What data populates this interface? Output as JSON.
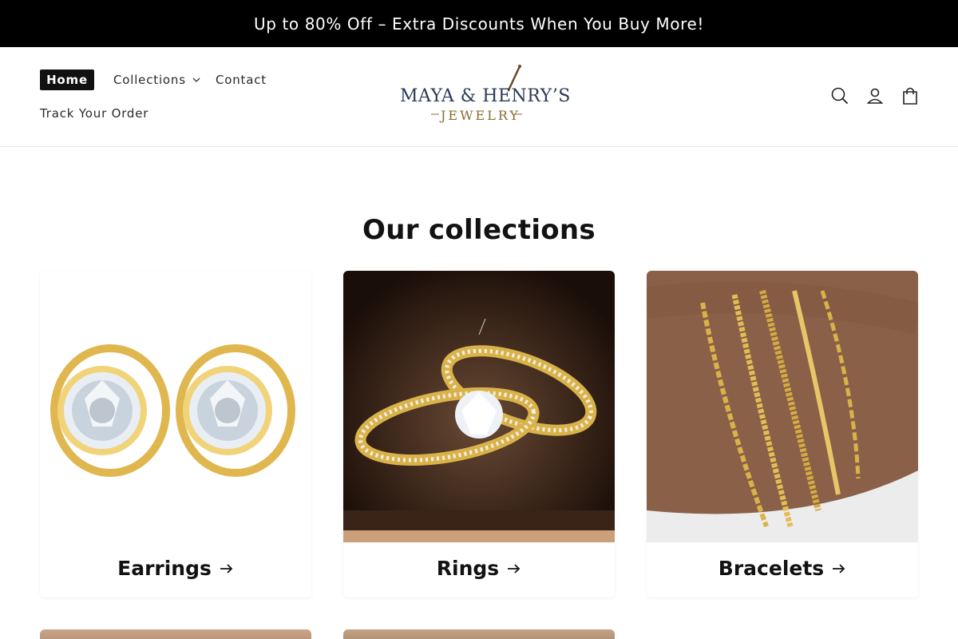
{
  "announcement": {
    "text": "Up to 80% Off – Extra Discounts When You Buy More!"
  },
  "nav": {
    "home": "Home",
    "collections": "Collections",
    "contact": "Contact",
    "track_order": "Track Your Order"
  },
  "logo": {
    "main": "MAYA & HENRY’S",
    "sub": "JEWELRY"
  },
  "icons": {
    "search": "search-icon",
    "account": "account-icon",
    "cart": "cart-icon"
  },
  "section": {
    "title": "Our collections"
  },
  "collections": [
    {
      "title": "Earrings"
    },
    {
      "title": "Rings"
    },
    {
      "title": "Bracelets"
    }
  ],
  "colors": {
    "announcement_bg": "#000000",
    "logo_navy": "#2b3a55",
    "logo_gold": "#8a6b2f",
    "gold": "#d9b24a"
  }
}
